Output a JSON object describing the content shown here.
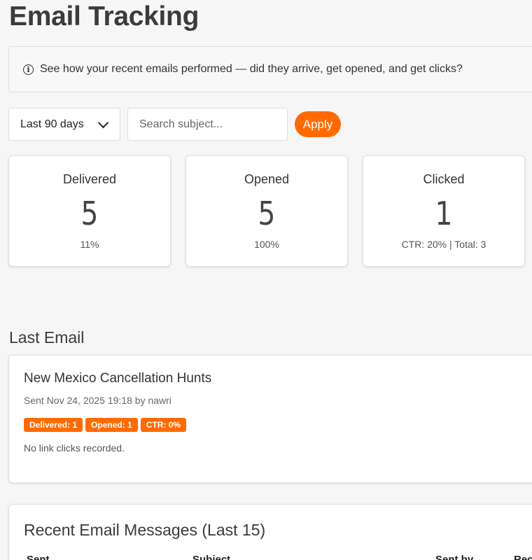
{
  "page": {
    "title": "Email Tracking"
  },
  "info": {
    "icon": "info-circle-icon",
    "text": "See how your recent emails performed — did they arrive, get opened, and get clicks?"
  },
  "filters": {
    "range_value": "Last 90 days",
    "search_value": "",
    "search_placeholder": "Search subject...",
    "apply_label": "Apply"
  },
  "stats": [
    {
      "label": "Delivered",
      "value": "5",
      "sub": "11%"
    },
    {
      "label": "Opened",
      "value": "5",
      "sub": "100%"
    },
    {
      "label": "Clicked",
      "value": "1",
      "sub": "CTR: 20% | Total: 3"
    }
  ],
  "last_email": {
    "heading": "Last Email",
    "subject": "New Mexico Cancellation Hunts",
    "meta": "Sent Nov 24, 2025 19:18 by nawri",
    "badges": [
      "Delivered: 1",
      "Opened: 1",
      "CTR: 0%"
    ],
    "note": "No link clicks recorded."
  },
  "recent": {
    "title": "Recent Email Messages (Last 15)",
    "columns": [
      "Sent",
      "Subject",
      "Sent by",
      "Rec"
    ]
  },
  "colors": {
    "accent": "#ff6b00",
    "background": "#f6f6f6"
  }
}
